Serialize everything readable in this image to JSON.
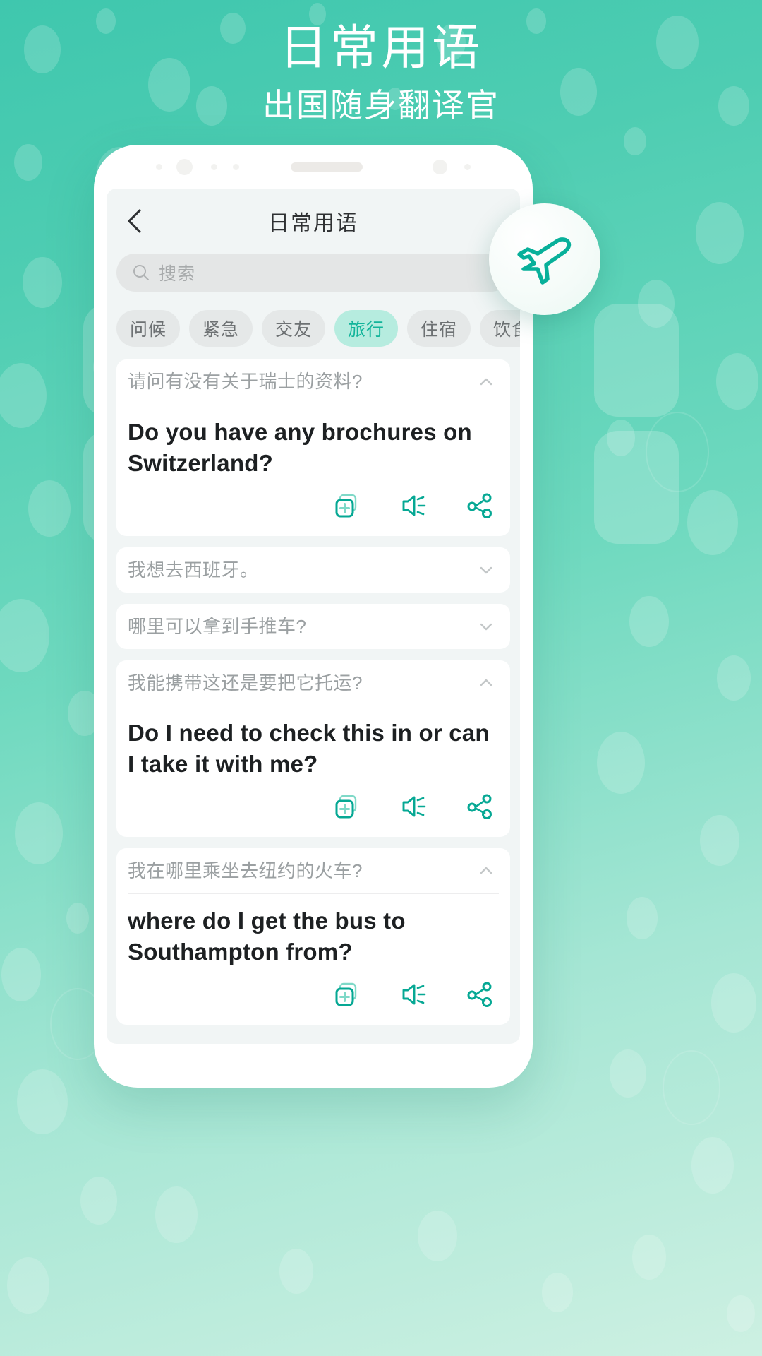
{
  "hero": {
    "title": "日常用语",
    "subtitle": "出国随身翻译官"
  },
  "colors": {
    "brand_teal": "#11b49a",
    "bg_gradient_top": "#3fc7ae",
    "bg_gradient_bottom": "#cdf0e2",
    "chip_active_bg": "#b6ecdf",
    "chip_bg": "#e5e8e8",
    "screen_bg": "#f1f5f5",
    "card_bg": "#ffffff",
    "cn_text": "#9ba0a2",
    "en_text": "#1d2022"
  },
  "screen": {
    "title": "日常用语",
    "back_icon": "chevron-left-icon",
    "search": {
      "placeholder": "搜索",
      "icon": "search-icon",
      "value": ""
    },
    "chips": [
      {
        "label": "问候",
        "active": false
      },
      {
        "label": "紧急",
        "active": false
      },
      {
        "label": "交友",
        "active": false
      },
      {
        "label": "旅行",
        "active": true
      },
      {
        "label": "住宿",
        "active": false
      },
      {
        "label": "饮食",
        "active": false
      }
    ],
    "action_icons": {
      "add": "add-to-collection-icon",
      "speak": "speaker-icon",
      "share": "share-icon"
    },
    "phrases": [
      {
        "cn": "请问有没有关于瑞士的资料?",
        "en": "Do you have any brochures on Switzerland?",
        "expanded": true,
        "chevron": "chevron-up-icon"
      },
      {
        "cn": "我想去西班牙。",
        "en": "",
        "expanded": false,
        "chevron": "chevron-down-icon"
      },
      {
        "cn": "哪里可以拿到手推车?",
        "en": "",
        "expanded": false,
        "chevron": "chevron-down-icon"
      },
      {
        "cn": "我能携带这还是要把它托运?",
        "en": "Do I need to check this in or can I take it with me?",
        "expanded": true,
        "chevron": "chevron-up-icon"
      },
      {
        "cn": "我在哪里乘坐去纽约的火车?",
        "en": "where do I get the bus to Southampton from?",
        "expanded": true,
        "chevron": "chevron-up-icon"
      }
    ]
  },
  "badge": {
    "icon": "airplane-icon"
  }
}
